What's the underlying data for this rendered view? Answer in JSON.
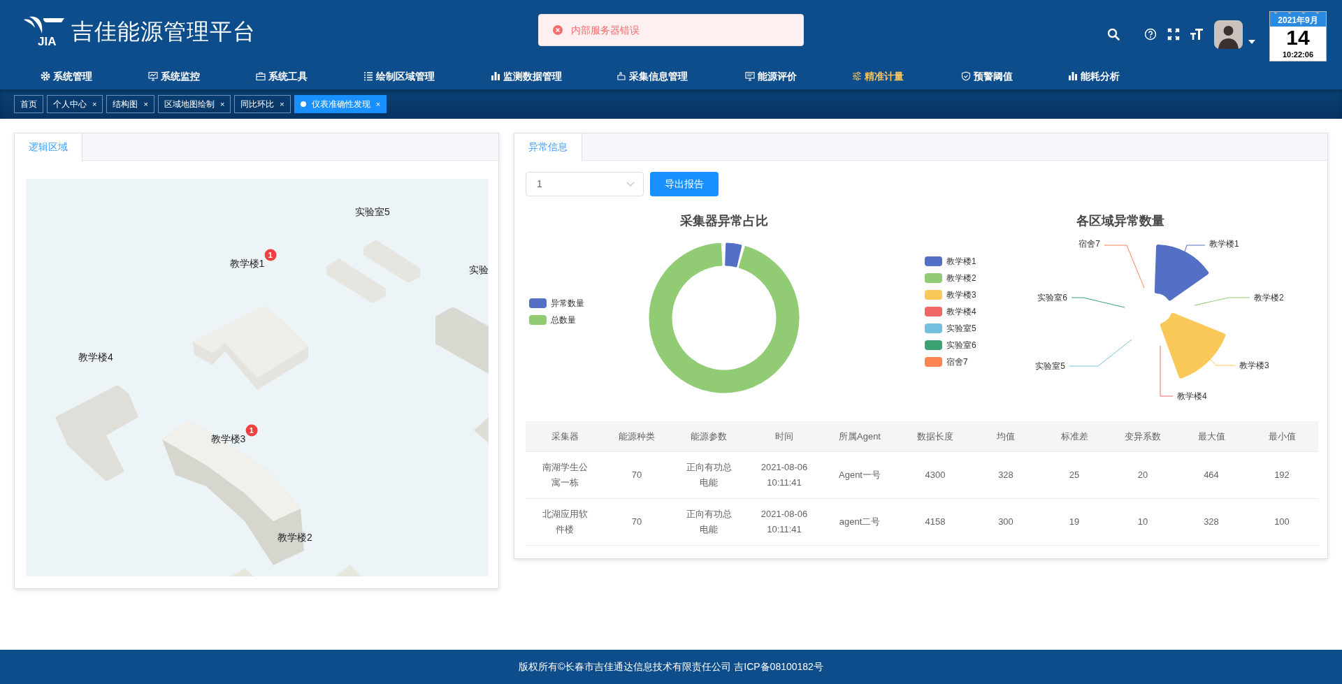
{
  "header": {
    "logo_mark": "JIA",
    "title": "吉佳能源管理平台",
    "toast": {
      "message": "内部服务器错误"
    },
    "calendar": {
      "month": "2021年9月",
      "day": "14",
      "time": "10:22:06"
    }
  },
  "nav": [
    {
      "label": "系统管理",
      "selected": false
    },
    {
      "label": "系统监控",
      "selected": false
    },
    {
      "label": "系统工具",
      "selected": false
    },
    {
      "label": "绘制区域管理",
      "selected": false
    },
    {
      "label": "监测数据管理",
      "selected": false
    },
    {
      "label": "采集信息管理",
      "selected": false
    },
    {
      "label": "能源评价",
      "selected": false
    },
    {
      "label": "精准计量",
      "selected": true
    },
    {
      "label": "预警阈值",
      "selected": false
    },
    {
      "label": "能耗分析",
      "selected": false
    }
  ],
  "tabs": [
    {
      "label": "首页",
      "selected": false
    },
    {
      "label": "个人中心",
      "close": "×",
      "selected": false
    },
    {
      "label": "结构图",
      "close": "×",
      "selected": false
    },
    {
      "label": "区域地图绘制",
      "close": "×",
      "selected": false
    },
    {
      "label": "同比环比",
      "close": "×",
      "selected": false
    },
    {
      "label": "仪表准确性发现",
      "close": "×",
      "selected": true
    }
  ],
  "left_panel": {
    "tab": "逻辑区域",
    "map_markers": [
      {
        "label": "实验室5"
      },
      {
        "label": "教学楼1",
        "badge": "1"
      },
      {
        "label": "实验"
      },
      {
        "label": "教学楼4"
      },
      {
        "label": "教学楼3",
        "badge": "1"
      },
      {
        "label": "教学楼2"
      }
    ]
  },
  "right_panel": {
    "tab": "异常信息",
    "select": {
      "value": "1"
    },
    "export_button": "导出报告",
    "donut": {
      "title": "采集器异常占比",
      "legend": [
        {
          "label": "异常数量",
          "color": "#5470c6"
        },
        {
          "label": "总数量",
          "color": "#91cc75"
        }
      ]
    },
    "rose": {
      "title": "各区域异常数量",
      "legend": [
        {
          "label": "教学楼1",
          "color": "#5470c6"
        },
        {
          "label": "教学楼2",
          "color": "#91cc75"
        },
        {
          "label": "教学楼3",
          "color": "#fac858"
        },
        {
          "label": "教学楼4",
          "color": "#ee6666"
        },
        {
          "label": "实验室5",
          "color": "#73c0de"
        },
        {
          "label": "实验室6",
          "color": "#3ba272"
        },
        {
          "label": "宿舍7",
          "color": "#fc8452"
        }
      ],
      "labels": [
        "教学楼1",
        "教学楼2",
        "教学楼3",
        "教学楼4",
        "实验室5",
        "实验室6",
        "宿舍7"
      ]
    },
    "table": {
      "columns": [
        "采集器",
        "能源种类",
        "能源参数",
        "时间",
        "所属Agent",
        "数据长度",
        "均值",
        "标准差",
        "变异系数",
        "最大值",
        "最小值"
      ],
      "rows": [
        [
          "南湖学生公寓一栋",
          "70",
          "正向有功总电能",
          "2021-08-06 10:11:41",
          "Agent一号",
          "4300",
          "328",
          "25",
          "20",
          "464",
          "192"
        ],
        [
          "北湖应用软件楼",
          "70",
          "正向有功总电能",
          "2021-08-06 10:11:41",
          "agent二号",
          "4158",
          "300",
          "19",
          "10",
          "328",
          "100"
        ]
      ]
    }
  },
  "footer": "版权所有©长春市吉佳通达信息技术有限责任公司 吉ICP备08100182号"
}
